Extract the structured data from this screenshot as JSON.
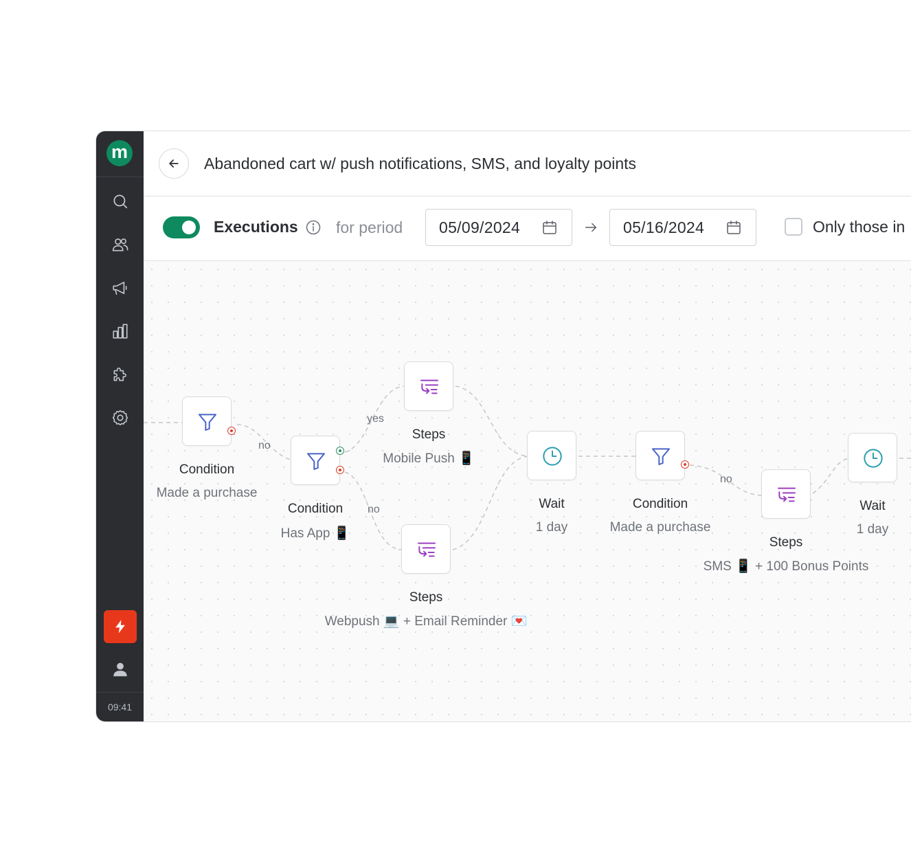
{
  "sidebar": {
    "logo_letter": "m",
    "clock": "09:41",
    "items": [
      {
        "icon": "search-icon"
      },
      {
        "icon": "users-icon"
      },
      {
        "icon": "megaphone-icon"
      },
      {
        "icon": "bar-chart-icon"
      },
      {
        "icon": "puzzle-icon"
      },
      {
        "icon": "gear-icon"
      }
    ]
  },
  "header": {
    "title": "Abandoned cart w/ push notifications, SMS, and loyalty points"
  },
  "toolbar": {
    "executions_label": "Executions",
    "period_label": "for period",
    "date_from": "05/09/2024",
    "date_to": "05/16/2024",
    "only_label": "Only those in",
    "executions_enabled": true
  },
  "flow": {
    "nodes": [
      {
        "type": "condition",
        "title": "Condition",
        "subtitle": "Made a purchase"
      },
      {
        "type": "condition",
        "title": "Condition",
        "subtitle": "Has App 📱"
      },
      {
        "type": "steps",
        "title": "Steps",
        "subtitle": "Mobile Push 📱"
      },
      {
        "type": "steps",
        "title": "Steps",
        "subtitle": "Webpush 💻 + Email Reminder 💌"
      },
      {
        "type": "wait",
        "title": "Wait",
        "subtitle": "1 day"
      },
      {
        "type": "condition",
        "title": "Condition",
        "subtitle": "Made a purchase"
      },
      {
        "type": "steps",
        "title": "Steps",
        "subtitle": "SMS 📱 + 100 Bonus Points"
      },
      {
        "type": "wait",
        "title": "Wait",
        "subtitle": "1 day"
      }
    ],
    "edge_labels": [
      "no",
      "yes",
      "no",
      "no"
    ]
  },
  "colors": {
    "accent": "#0e8a5f",
    "sidebar_bg": "#2b2d31",
    "bolt_bg": "#e8381c",
    "condition_icon": "#4a63c9",
    "steps_icon": "#9b3fc2",
    "wait_icon": "#2a9fae"
  }
}
